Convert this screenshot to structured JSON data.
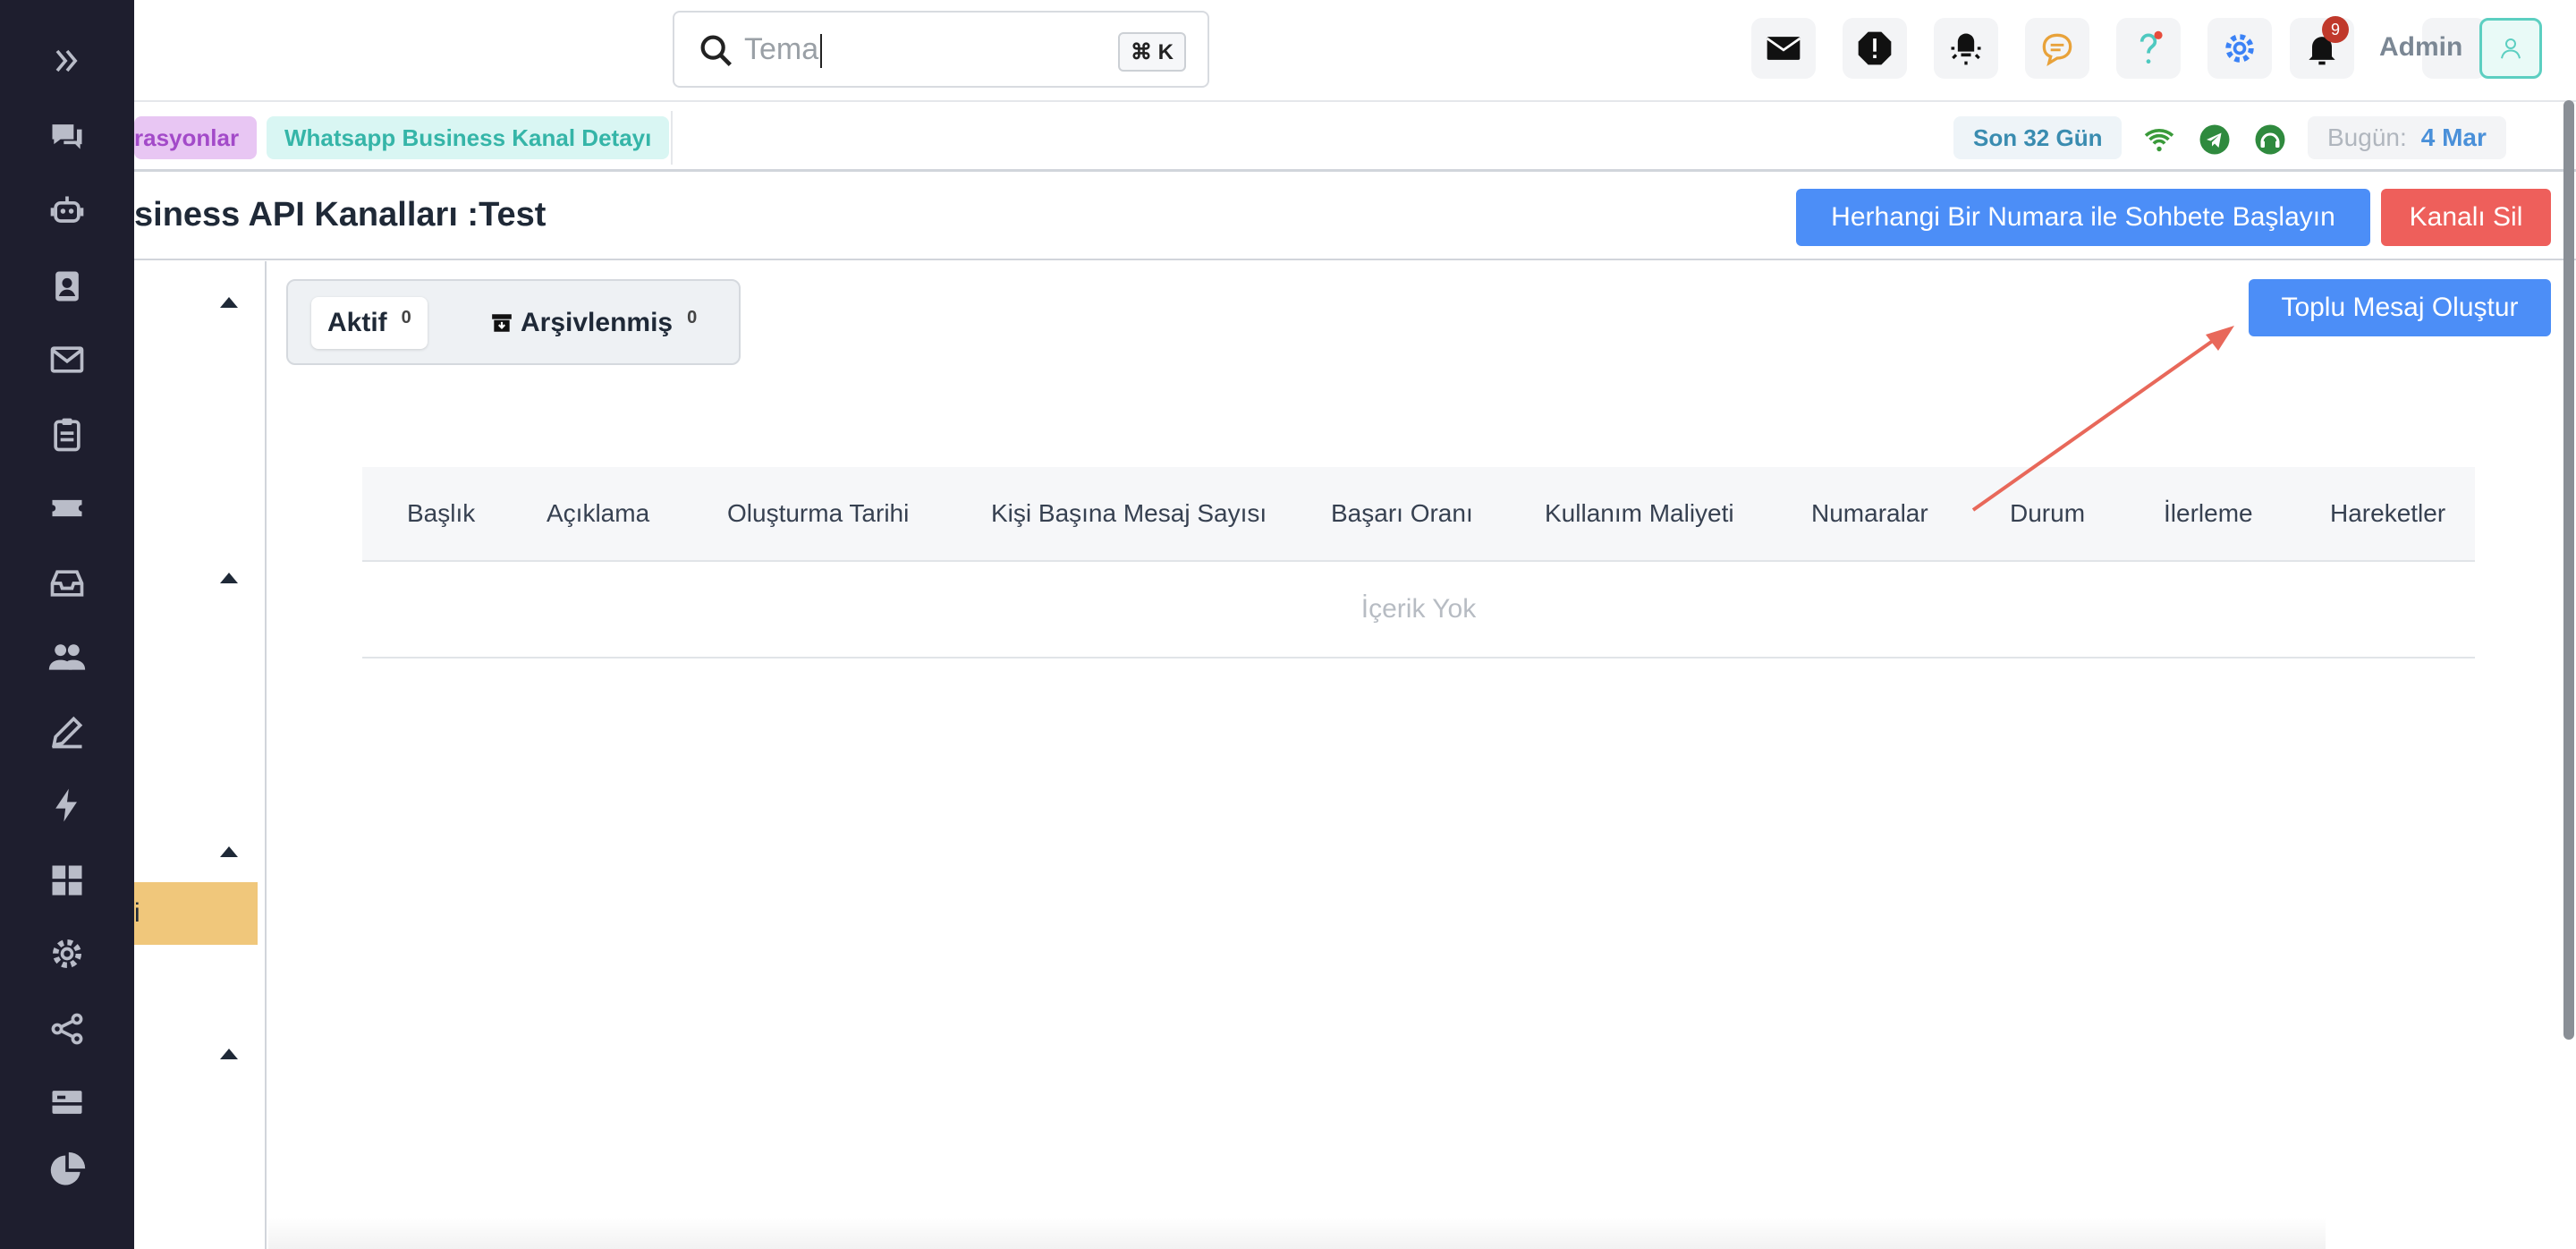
{
  "search": {
    "value": "Tema",
    "shortcut": "⌘ K"
  },
  "header": {
    "notification_count": "9",
    "user_name": "Admin"
  },
  "tabs": {
    "partial_tab": "rasyonlar",
    "active_tab": "Whatsapp Business Kanal Detayı",
    "period": "Son 32 Gün",
    "today_label": "Bugün:",
    "today_value": "4 Mar"
  },
  "page": {
    "title": "siness API Kanalları :Test",
    "start_chat_button": "Herhangi Bir Numara ile Sohbete Başlayın",
    "delete_channel_button": "Kanalı Sil",
    "bulk_message_button": "Toplu Mesaj Oluştur"
  },
  "left_panel": {
    "selected_item_partial": "i"
  },
  "segment": {
    "active_label": "Aktif",
    "active_count": "0",
    "archived_label": "Arşivlenmiş",
    "archived_count": "0"
  },
  "table": {
    "columns": [
      "Başlık",
      "Açıklama",
      "Oluşturma Tarihi",
      "Kişi Başına Mesaj Sayısı",
      "Başarı Oranı",
      "Kullanım Maliyeti",
      "Numaralar",
      "Durum",
      "İlerleme",
      "Hareketler"
    ],
    "empty_text": "İçerik Yok"
  },
  "colors": {
    "sidebar_bg": "#1e1e2e",
    "primary_blue": "#4c8ef7",
    "danger_red": "#ee5f5b",
    "annotation_arrow": "#e8685a"
  }
}
